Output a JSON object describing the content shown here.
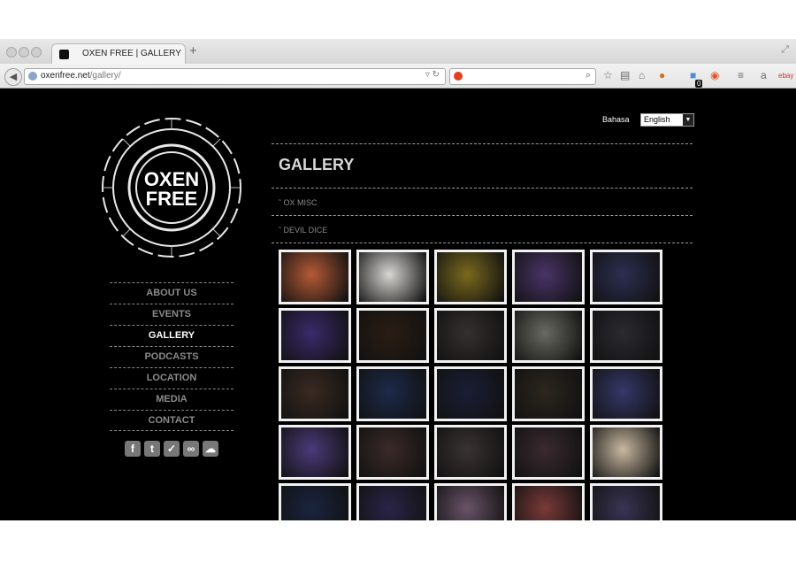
{
  "browser": {
    "tab_title": "OXEN FREE | GALLERY",
    "url_domain": "oxenfree.net",
    "url_path": "/gallery/",
    "new_tab_symbol": "+",
    "badge_count": "0"
  },
  "site": {
    "logo_text_line1": "OXEN",
    "logo_text_line2": "FREE",
    "nav": [
      {
        "label": "ABOUT US",
        "active": false
      },
      {
        "label": "EVENTS",
        "active": false
      },
      {
        "label": "GALLERY",
        "active": true
      },
      {
        "label": "PODCASTS",
        "active": false
      },
      {
        "label": "LOCATION",
        "active": false
      },
      {
        "label": "MEDIA",
        "active": false
      },
      {
        "label": "CONTACT",
        "active": false
      }
    ],
    "language_label": "Bahasa",
    "language_value": "English",
    "page_title": "GALLERY",
    "albums": [
      "˜ OX MISC",
      "˜ DEVIL DICE"
    ]
  },
  "colors": {
    "background": "#000000",
    "nav_active": "#ffffff",
    "nav_inactive": "#8b8b8b",
    "thumb_frame": "#f1f1f1"
  },
  "icons": [
    "facebook-icon",
    "twitter-icon",
    "checkmark-icon",
    "tripadvisor-icon",
    "cloud-icon"
  ],
  "gallery_photo_colors": [
    [
      "#b45a36",
      "#d8d6d2",
      "#7a6a1c",
      "#4a3468",
      "#2c2f52"
    ],
    [
      "#3a2a6c",
      "#2a1d14",
      "#34302e",
      "#6a6a62",
      "#2b2a31"
    ],
    [
      "#3a2a22",
      "#1c2a4a",
      "#1a1e36",
      "#2c261e",
      "#35386a"
    ],
    [
      "#4b3a7a",
      "#3a2a28",
      "#3a3232",
      "#3a2a30",
      "#c8b8a0"
    ],
    [
      "#1b2440",
      "#2a2448",
      "#6a5468",
      "#7a3a38",
      "#3a3454"
    ]
  ]
}
